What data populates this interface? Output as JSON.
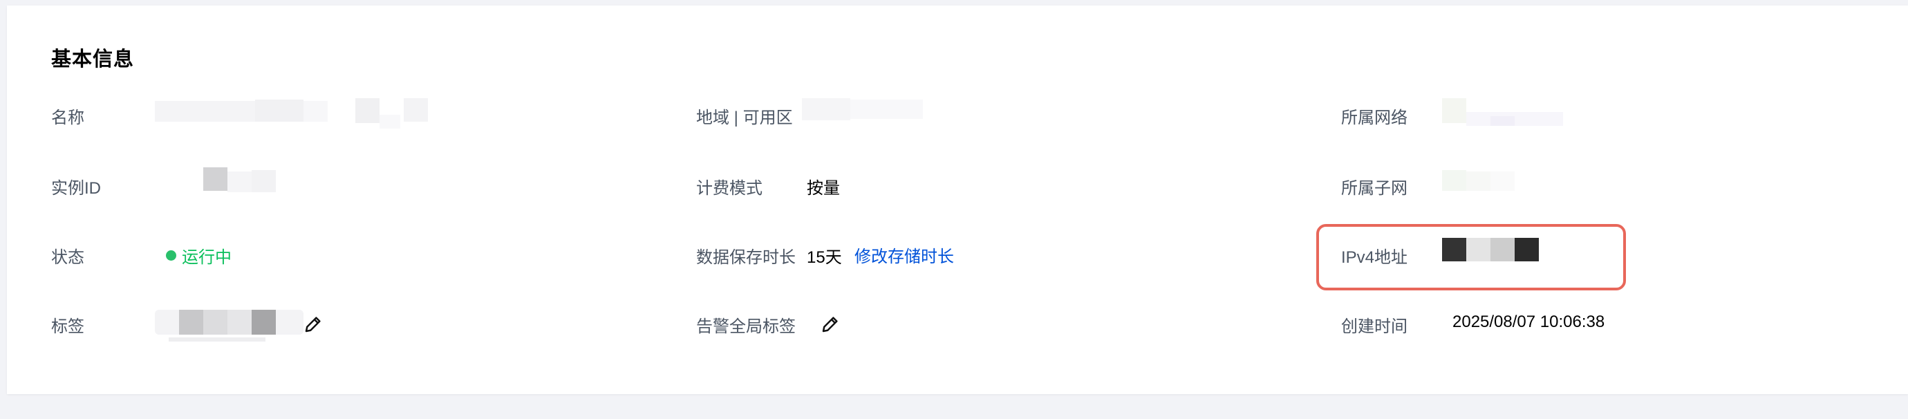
{
  "section": {
    "title": "基本信息"
  },
  "fields": {
    "name_label": "名称",
    "instance_id_label": "实例ID",
    "status_label": "状态",
    "status_value": "运行中",
    "tags_label": "标签",
    "region_label": "地域 | 可用区",
    "billing_label": "计费模式",
    "billing_value": "按量",
    "retention_label": "数据保存时长",
    "retention_value": "15天",
    "retention_link": "修改存储时长",
    "alert_tags_label": "告警全局标签",
    "network_label": "所属网络",
    "subnet_label": "所属子网",
    "ipv4_label": "IPv4地址",
    "created_label": "创建时间",
    "created_value": "2025/08/07 10:06:38"
  },
  "colors": {
    "status_green": "#0abf5b",
    "link_blue": "#0052d9",
    "highlight_red": "#e8675a"
  },
  "icons": {
    "tags_edit": "pencil-icon",
    "alert_tags_edit": "pencil-icon"
  }
}
